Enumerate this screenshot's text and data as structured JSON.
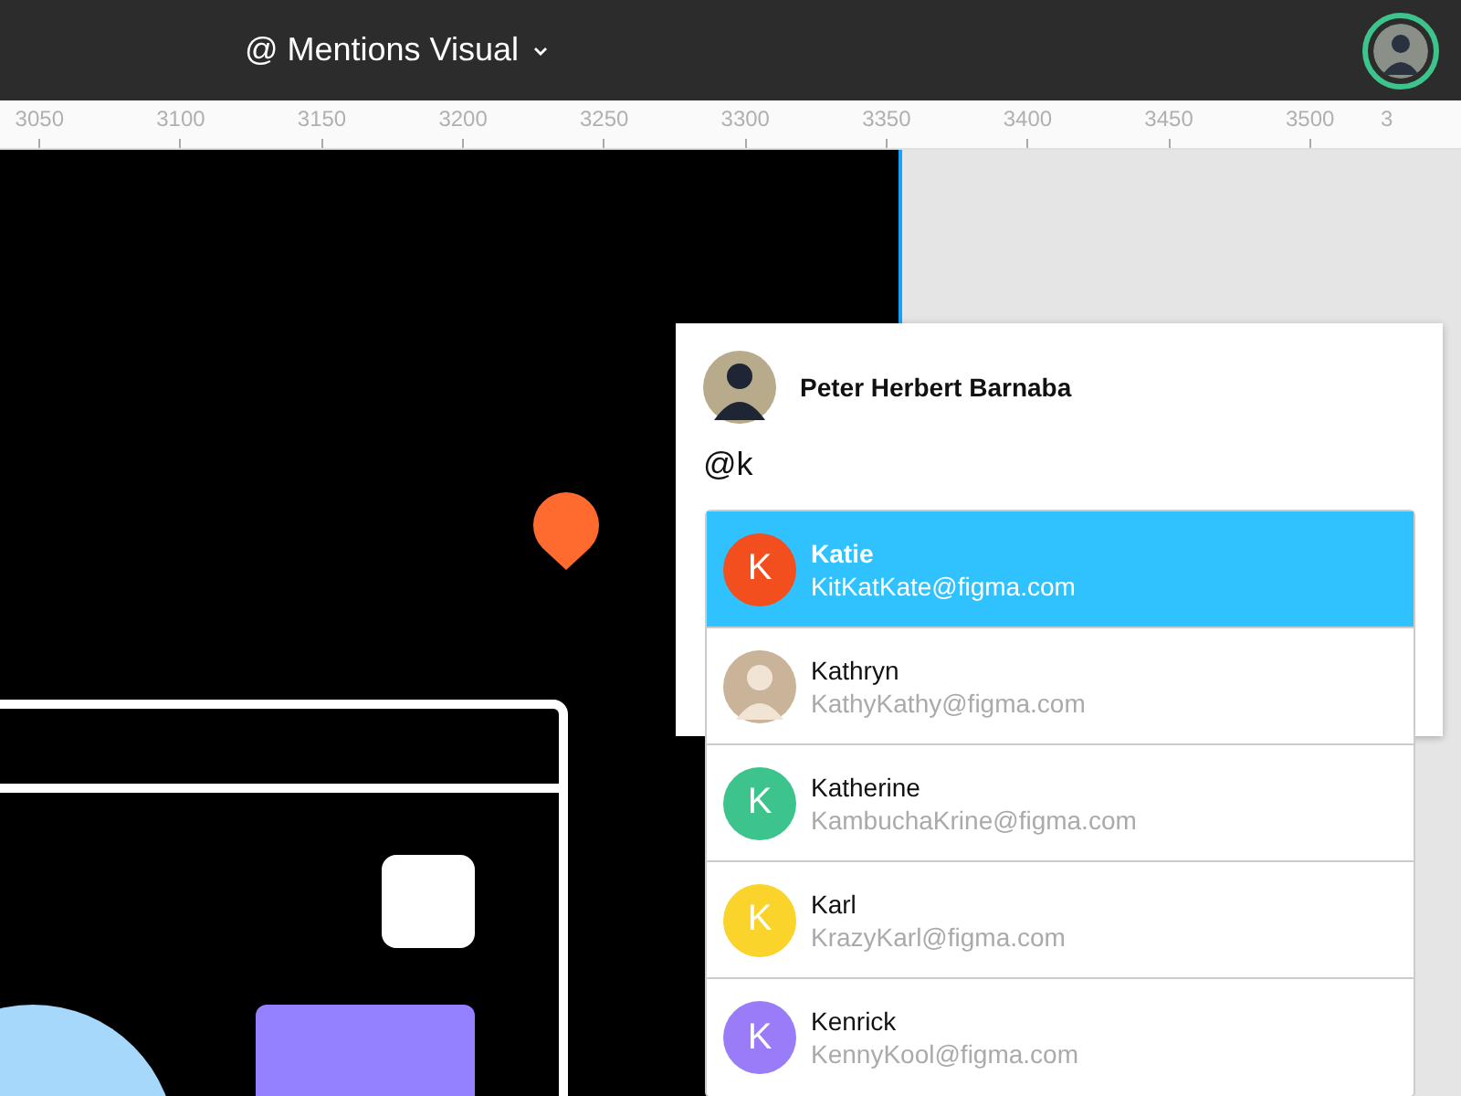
{
  "topbar": {
    "title": "@ Mentions Visual"
  },
  "ruler": {
    "labels": [
      "3050",
      "3100",
      "3150",
      "3200",
      "3250",
      "3300",
      "3350",
      "3400",
      "3450",
      "3500",
      "3"
    ]
  },
  "comment": {
    "author": "Peter Herbert Barnaba",
    "value": "@k"
  },
  "suggestions": [
    {
      "name": "Katie",
      "email": "KitKatKate@figma.com",
      "kind": "letter",
      "initial": "K",
      "color": "#f24e1e",
      "selected": true
    },
    {
      "name": "Kathryn",
      "email": "KathyKathy@figma.com",
      "kind": "photo",
      "selected": false
    },
    {
      "name": "Katherine",
      "email": "KambuchaKrine@figma.com",
      "kind": "letter",
      "initial": "K",
      "color": "#3dc48c",
      "selected": false
    },
    {
      "name": "Karl",
      "email": "KrazyKarl@figma.com",
      "kind": "letter",
      "initial": "K",
      "color": "#fad42a",
      "selected": false
    },
    {
      "name": "Kenrick",
      "email": "KennyKool@figma.com",
      "kind": "letter",
      "initial": "K",
      "color": "#9b7cf8",
      "selected": false
    }
  ]
}
